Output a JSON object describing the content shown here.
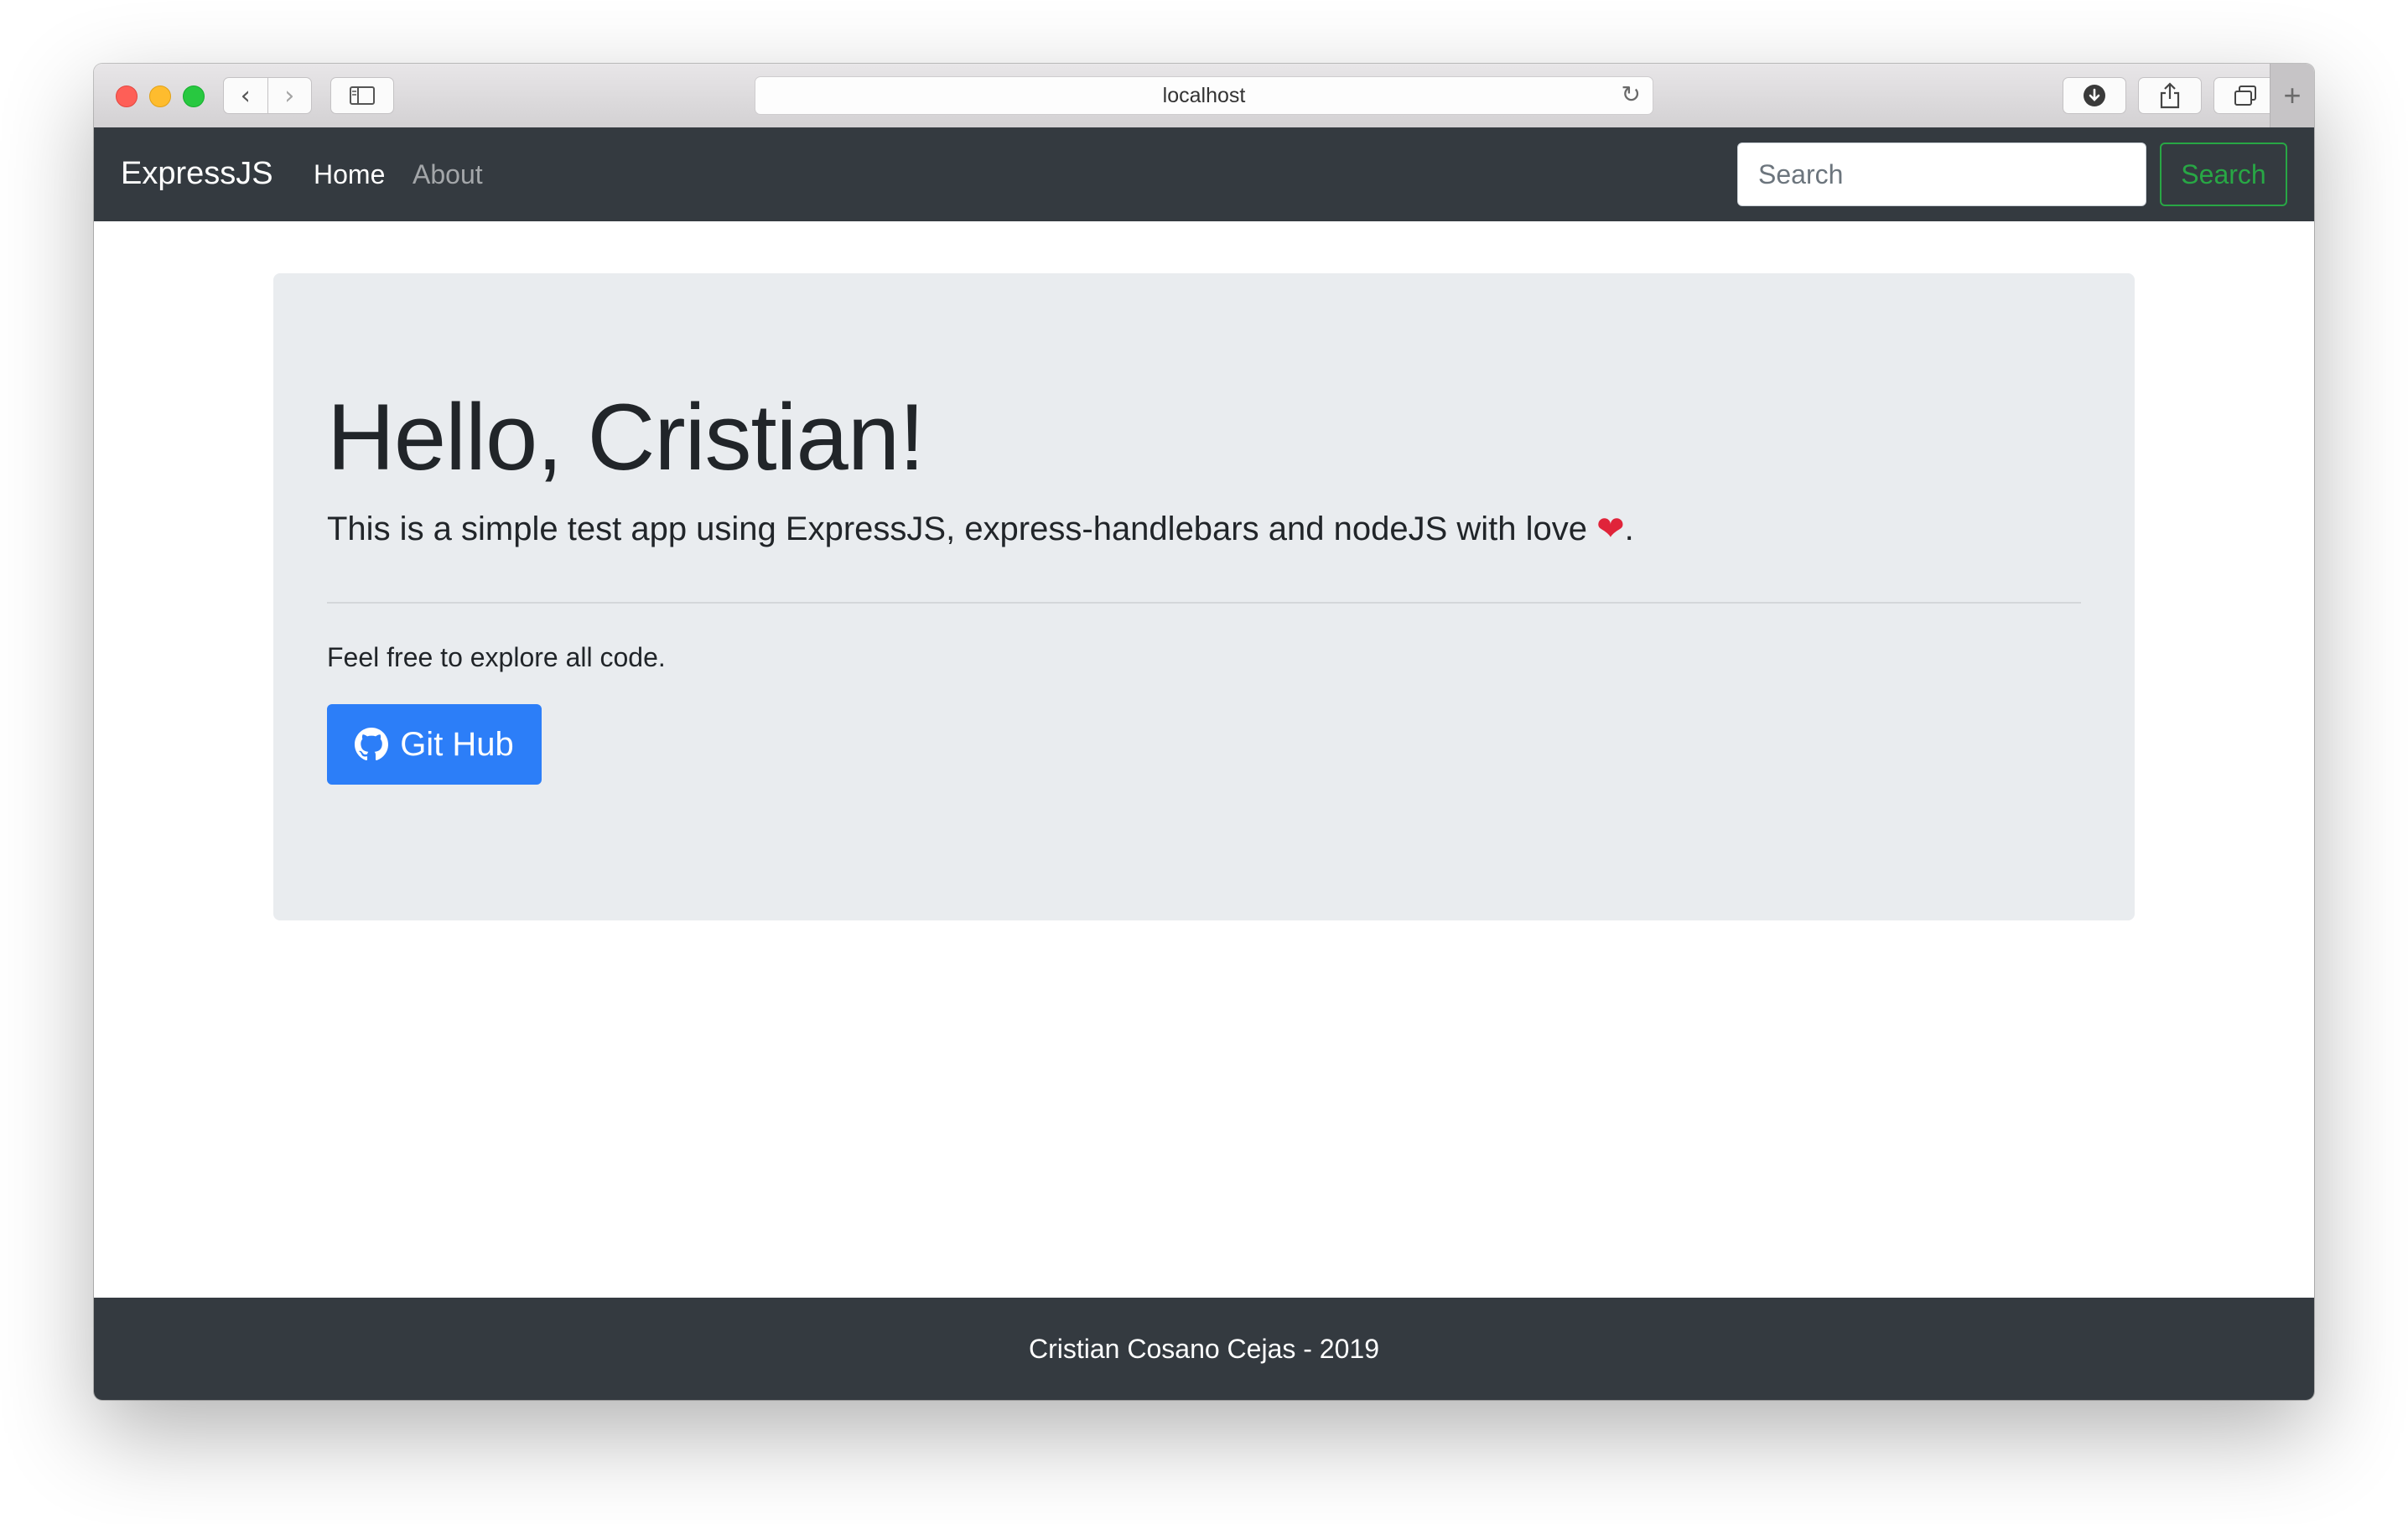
{
  "browser": {
    "url": "localhost",
    "back_icon": "‹",
    "forward_icon": "›",
    "reload_icon": "↻",
    "new_tab_icon": "+"
  },
  "navbar": {
    "brand": "ExpressJS",
    "links": [
      {
        "label": "Home",
        "active": true
      },
      {
        "label": "About",
        "active": false
      }
    ],
    "search_placeholder": "Search",
    "search_button": "Search",
    "background": "#343a40",
    "search_accent": "#28a745"
  },
  "jumbotron": {
    "heading": "Hello, Cristian!",
    "lead": "This is a simple test app using ExpressJS, express-handlebars and nodeJS with love ",
    "heart": "❤",
    "lead_end": ".",
    "body": "Feel free to explore all code.",
    "button_label": "Git Hub",
    "button_icon": "github-icon",
    "button_color": "#2c7ef8",
    "background": "#e9ecef"
  },
  "footer": {
    "text": "Cristian Cosano Cejas - 2019"
  }
}
